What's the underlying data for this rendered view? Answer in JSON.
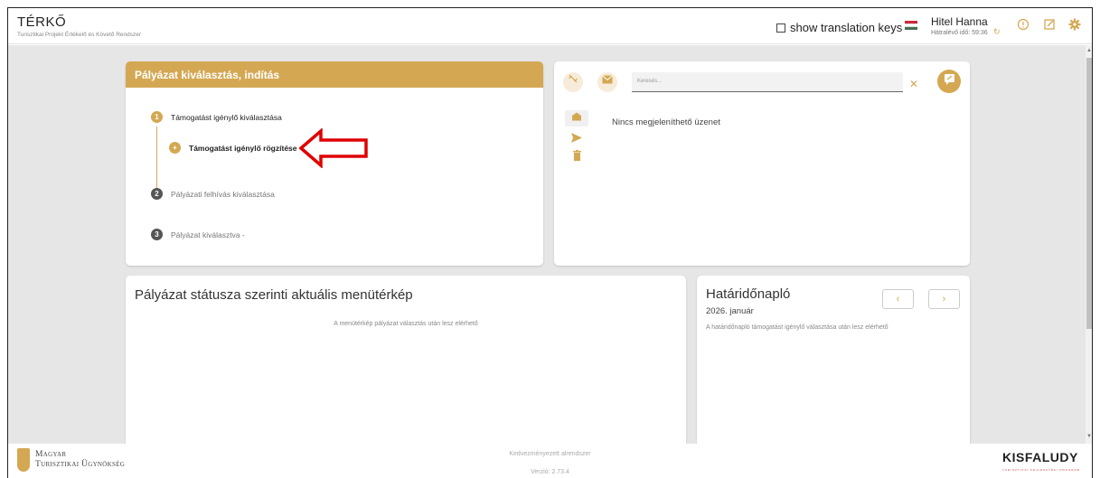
{
  "header": {
    "app_title": "TÉRKŐ",
    "app_subtitle": "Turisztikai Projekt Értékelő és Követő Rendszer",
    "translation_toggle_label": "show translation keys",
    "user_name": "Hitel Hanna",
    "session_timer": "Hátralévő idő: 59:36"
  },
  "selection_card": {
    "title": "Pályázat kiválasztás, indítás",
    "steps": [
      {
        "number": "1",
        "label": "Támogatást igénylő kiválasztása"
      },
      {
        "number": "+",
        "label": "Támogatást igénylő rögzítése"
      },
      {
        "number": "2",
        "label": "Pályázati felhívás kiválasztása"
      },
      {
        "number": "3",
        "label": "Pályázat kiválasztva -"
      }
    ]
  },
  "messages_card": {
    "search_placeholder": "Keresés...",
    "clear_symbol": "✕",
    "empty_text": "Nincs megjeleníthető üzenet"
  },
  "menu_map_card": {
    "title": "Pályázat státusza szerinti aktuális menütérkép",
    "placeholder": "A menütérkép pályázat választás után lesz elérhető"
  },
  "deadline_card": {
    "title": "Határidőnapló",
    "month": "2026. január",
    "placeholder": "A határidőnapló támogatást igénylő választása után lesz elérhető",
    "prev_symbol": "‹",
    "next_symbol": "›"
  },
  "footer": {
    "logo_left_line1": "Magyar",
    "logo_left_line2": "Turisztikai Ügynökség",
    "environment": "Kedvezményezett alrendszer",
    "version": "Verzió: 2.73.4",
    "logo_right": "KISFALUDY",
    "logo_right_sub": "TURISZTIKAI FEJLESZTÉSI PROGRAM"
  },
  "colors": {
    "accent_gold": "#d4a853",
    "annotation_red": "#e00000"
  }
}
